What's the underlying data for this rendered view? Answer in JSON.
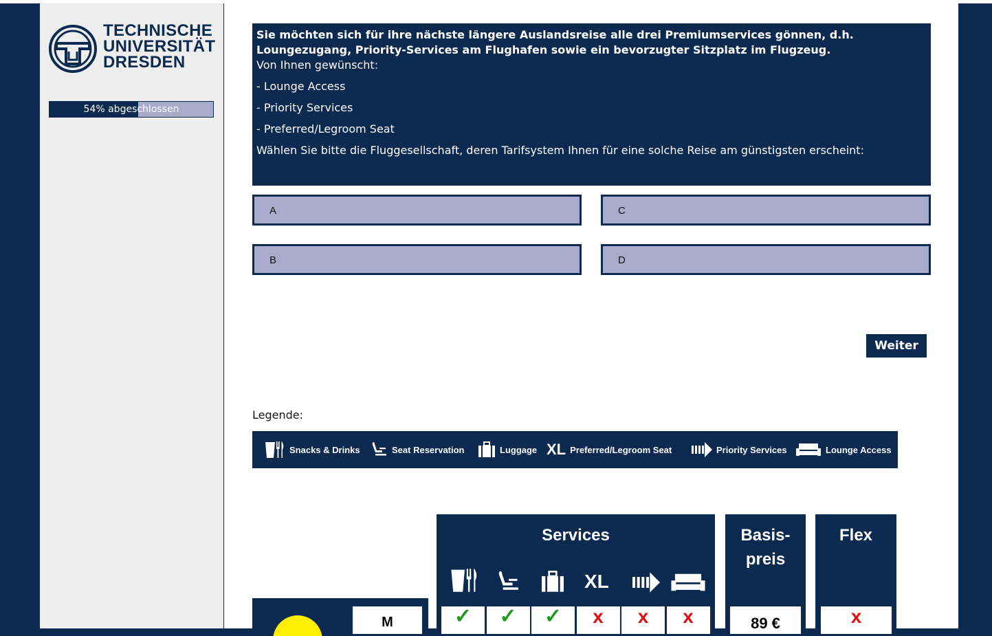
{
  "university": {
    "line1": "TECHNISCHE",
    "line2": "UNIVERSITÄT",
    "line3": "DRESDEN"
  },
  "progress": {
    "text": "54% abgeschlossen",
    "percent": 54
  },
  "question": {
    "bold_text": "Sie möchten sich für ihre nächste längere Auslandsreise alle drei Premiumservices gönnen, d.h. Loungezugang, Priority-Services am Flughafen sowie ein bevorzugter Sitzplatz im Flugzeug.",
    "wish_label": "Von Ihnen gewünscht:",
    "items": [
      "- Lounge Access",
      "- Priority Services",
      "- Preferred/Legroom Seat"
    ],
    "instruction": "Wählen Sie bitte die Fluggesellschaft, deren Tarifsystem Ihnen für eine solche Reise am günstigsten erscheint:"
  },
  "answers": {
    "a": "A",
    "b": "B",
    "c": "C",
    "d": "D"
  },
  "next_button": "Weiter",
  "legend": {
    "label": "Legende:",
    "items": {
      "snacks": "Snacks & Drinks",
      "seat": "Seat Reservation",
      "luggage": "Luggage",
      "xl_icon": "XL",
      "legroom": "Preferred/Legroom Seat",
      "priority": "Priority Services",
      "lounge": "Lounge Access"
    }
  },
  "table": {
    "services_title": "Services",
    "xl_icon": "XL",
    "basis_line1": "Basis-",
    "basis_line2": "preis",
    "flex_title": "Flex",
    "row": {
      "size": "M",
      "services": [
        "check",
        "check",
        "check",
        "cross",
        "cross",
        "cross"
      ],
      "base_price": "89 €",
      "flex": "cross"
    },
    "symbols": {
      "check": "✓",
      "cross": "x"
    },
    "colors": {
      "check": "#1a9b1a",
      "cross": "#e01010",
      "airline_circle": "#ffee00"
    }
  },
  "colors": {
    "navy": "#0c2a50",
    "answer_bg": "#a8abcc"
  }
}
